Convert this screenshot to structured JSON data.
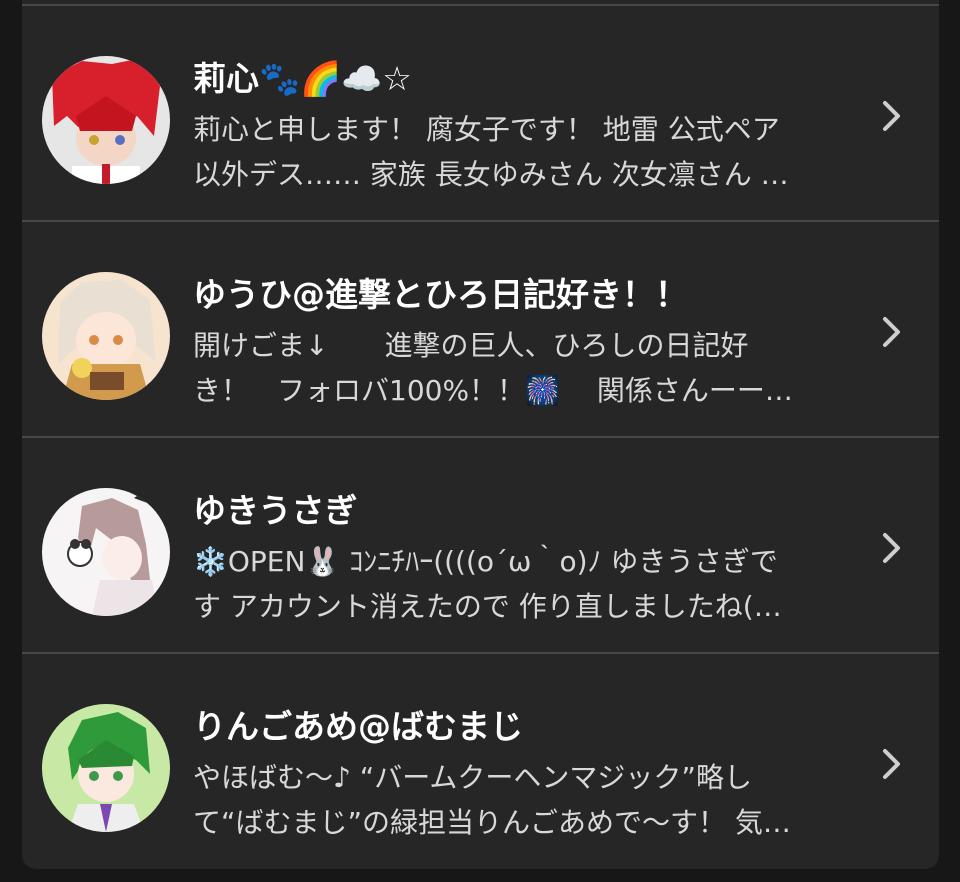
{
  "users": [
    {
      "name": "莉心🐾🌈☁️☆",
      "bio_line1": "莉心と申します！ 腐女子です！ 地雷 公式ペア",
      "bio_line2": "以外デス…… 家族 長女ゆみさん 次女凛さん …",
      "avatar_colors": {
        "bg": "#e6e6e6",
        "hair": "#d8202c",
        "skin": "#f3d6c6"
      }
    },
    {
      "name": "ゆうひ@進撃とひろ日記好き！！",
      "bio_line1": "開けごま↓　　進撃の巨人、ひろしの日記好",
      "bio_line2": "き！　フォロバ100%！！🎆　 関係さんーー…",
      "avatar_colors": {
        "bg": "#f6e4cf",
        "hair": "#eadfd3",
        "skin": "#fbe6d8"
      }
    },
    {
      "name": "ゆきうさぎ",
      "bio_line1": "❄️OPEN🐰 ｺﾝﾆﾁﾊｰ((((o´ω｀o)ﾉ ゆきうさぎで",
      "bio_line2": "す アカウント消えたので 作り直しましたね(…",
      "avatar_colors": {
        "bg": "#f7f4f5",
        "hair": "#b69b9a",
        "skin": "#fbeeea"
      }
    },
    {
      "name": "りんごあめ@ばむまじ",
      "bio_line1": "やほばむ〜♪ “バームクーヘンマジック”略し",
      "bio_line2": "て“ばむまじ”の緑担当りんごあめで〜す！ 気…",
      "avatar_colors": {
        "bg": "#c8e9a6",
        "hair": "#2f9a3a",
        "skin": "#fbe9e0"
      }
    }
  ]
}
